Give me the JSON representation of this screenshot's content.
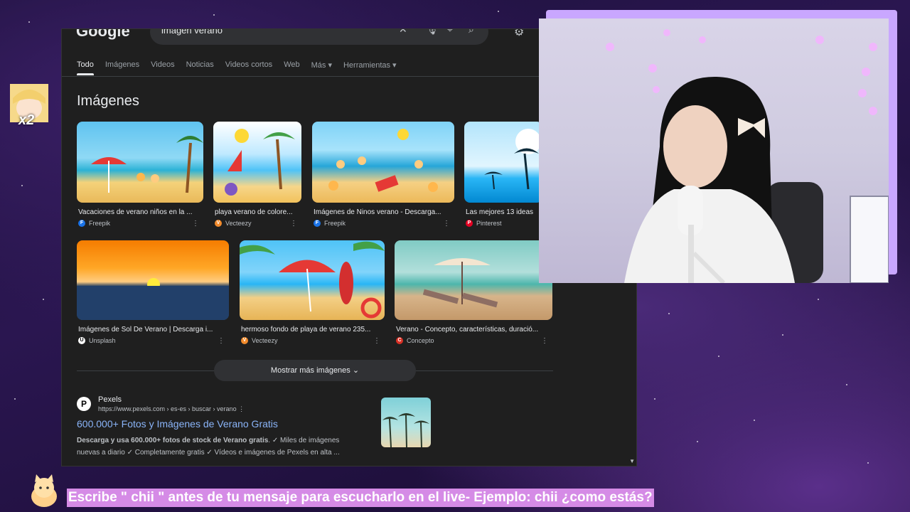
{
  "search": {
    "logo": "Google",
    "query": "imagen verano"
  },
  "tabs": [
    {
      "label": "Todo",
      "active": true
    },
    {
      "label": "Imágenes"
    },
    {
      "label": "Videos"
    },
    {
      "label": "Noticias"
    },
    {
      "label": "Videos cortos"
    },
    {
      "label": "Web"
    },
    {
      "label": "Más ▾"
    },
    {
      "label": "Herramientas ▾"
    }
  ],
  "images_section": {
    "title": "Imágenes",
    "row1": [
      {
        "caption": "Vacaciones de verano niños en la ...",
        "source": "Freepik",
        "source_color": "#1a73e8"
      },
      {
        "caption": "playa verano de colore...",
        "source": "Vecteezy",
        "source_color": "#f28b2c"
      },
      {
        "caption": "Imágenes de Ninos verano - Descarga...",
        "source": "Freepik",
        "source_color": "#1a73e8"
      },
      {
        "caption": "Las mejores 13 ideas",
        "source": "Pinterest",
        "source_color": "#e60023"
      }
    ],
    "row2": [
      {
        "caption": "Imágenes de Sol De Verano | Descarga i...",
        "source": "Unsplash",
        "source_color": "#ffffff"
      },
      {
        "caption": "hermoso fondo de playa de verano 235...",
        "source": "Vecteezy",
        "source_color": "#f28b2c"
      },
      {
        "caption": "Verano - Concepto, características, duració...",
        "source": "Concepto",
        "source_color": "#d93025"
      }
    ],
    "show_more": "Mostrar más imágenes"
  },
  "result": {
    "site_name": "Pexels",
    "url": "https://www.pexels.com › es-es › buscar › verano",
    "title": "600.000+ Fotos y Imágenes de Verano Gratis",
    "snippet_bold": "Descarga y usa 600.000+ fotos de stock de Verano gratis",
    "snippet_rest": ". ✓ Miles de imágenes nuevas a diario ✓ Completamente gratis ✓ Vídeos e imágenes de Pexels en alta ..."
  },
  "overlay": {
    "multiplier": "x2",
    "banner": "Escribe \" chii \" antes de tu mensaje para escucharlo en el live- Ejemplo: chii ¿como estás?"
  },
  "colors": {
    "accent_purple": "#c9a7ff",
    "banner_bg": "#d58be6",
    "link_blue": "#8ab4f8"
  }
}
